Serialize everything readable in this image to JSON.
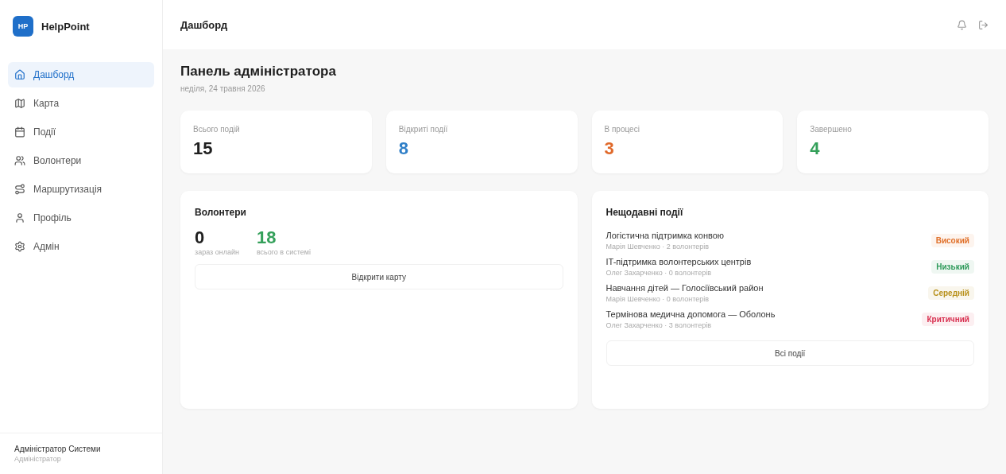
{
  "sidebar": {
    "logo": {
      "badge": "HP",
      "name": "HelpPoint"
    },
    "items": [
      {
        "label": "Дашборд",
        "selected": true
      },
      {
        "label": "Карта",
        "selected": false
      },
      {
        "label": "Події",
        "selected": false
      },
      {
        "label": "Волонтери",
        "selected": false
      },
      {
        "label": "Маршрутизація",
        "selected": false
      },
      {
        "label": "Профіль",
        "selected": false
      },
      {
        "label": "Адмін",
        "selected": false
      }
    ],
    "user": {
      "name": "Адміністратор Системи",
      "role": "Адміністратор"
    }
  },
  "header": {
    "title": "Дашборд"
  },
  "page": {
    "title": "Панель адміністратора",
    "date": "неділя, 24 травня 2026"
  },
  "stats": [
    {
      "label": "Всього подій",
      "value": "15",
      "color": "#1f1f1f"
    },
    {
      "label": "Відкриті події",
      "value": "8",
      "color": "#2f7fc8"
    },
    {
      "label": "В процесі",
      "value": "3",
      "color": "#e0692a"
    },
    {
      "label": "Завершено",
      "value": "4",
      "color": "#34a05a"
    }
  ],
  "volunteers": {
    "title": "Волонтери",
    "online": {
      "value": "0",
      "label": "зараз онлайн"
    },
    "total": {
      "value": "18",
      "label": "всього в системі"
    },
    "button": "Відкрити карту"
  },
  "recent": {
    "title": "Нещодавні події",
    "events": [
      {
        "title": "Логістична підтримка конвою",
        "meta": "Марія Шевченко · 2 волонтерів",
        "priority": "Високий",
        "color": "#e0702a"
      },
      {
        "title": "IT-підтримка волонтерських центрів",
        "meta": "Олег Захарченко · 0 волонтерів",
        "priority": "Низький",
        "color": "#2e9a5a"
      },
      {
        "title": "Навчання дітей — Голосіївський район",
        "meta": "Марія Шевченко · 0 волонтерів",
        "priority": "Середній",
        "color": "#b8901a"
      },
      {
        "title": "Термінова медична допомога — Оболонь",
        "meta": "Олег Захарченко · 3 волонтерів",
        "priority": "Критичний",
        "color": "#d83050"
      }
    ],
    "button": "Всі події"
  }
}
